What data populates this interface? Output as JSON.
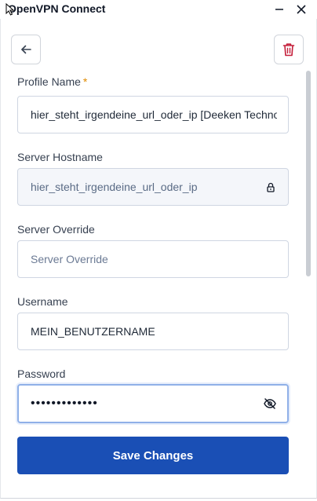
{
  "window": {
    "title": "OpenVPN Connect",
    "icons": {
      "minimize": "minimize-icon",
      "close": "close-icon",
      "cursor": "mouse-cursor-icon"
    }
  },
  "toolbar": {
    "back_icon": "arrow-left-icon",
    "delete_icon": "trash-icon",
    "delete_color": "#c41e3a"
  },
  "form": {
    "profile_name": {
      "label": "Profile Name",
      "required_mark": "*",
      "value": "hier_steht_irgendeine_url_oder_ip [Deeken Technol"
    },
    "server_hostname": {
      "label": "Server Hostname",
      "value": "hier_steht_irgendeine_url_oder_ip",
      "icon": "lock-icon"
    },
    "server_override": {
      "label": "Server Override",
      "placeholder": "Server Override",
      "value": ""
    },
    "username": {
      "label": "Username",
      "value": "MEIN_BENUTZERNAME"
    },
    "password": {
      "label": "Password",
      "value": "•••••••••••••",
      "icon": "eye-off-icon"
    }
  },
  "actions": {
    "save_label": "Save Changes",
    "save_color": "#1a4fb5"
  }
}
